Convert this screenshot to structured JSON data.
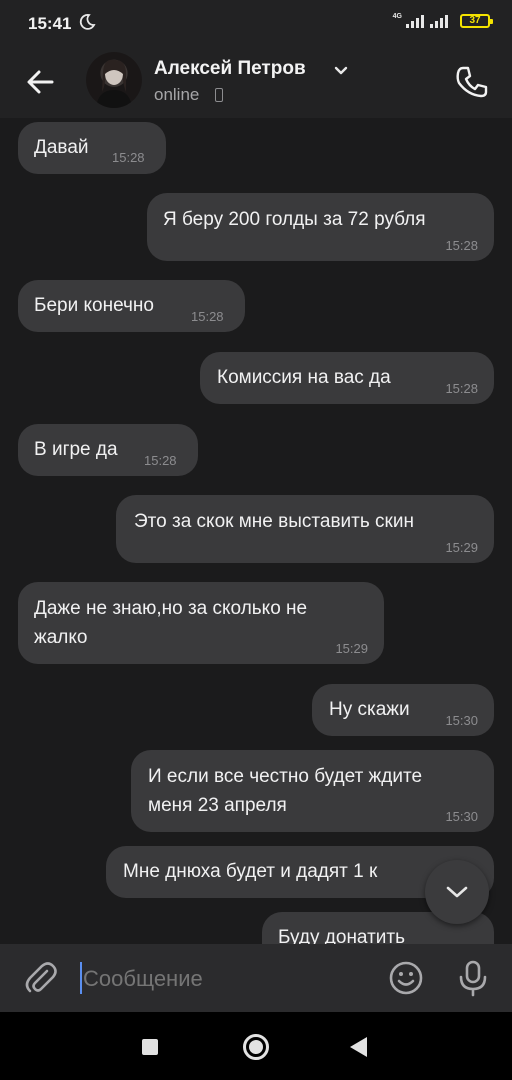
{
  "status_bar": {
    "time": "15:41",
    "network": "4G",
    "battery": "37",
    "icons": [
      "moon-icon",
      "signal-icon",
      "signal-icon",
      "battery-icon"
    ]
  },
  "header": {
    "contact_name": "Алексей Петров",
    "status": "online",
    "icons": [
      "back-arrow-icon",
      "chevron-down-icon",
      "phone-call-icon"
    ]
  },
  "messages": [
    {
      "direction": "incoming",
      "lines": [
        "Давай"
      ],
      "time": "15:28"
    },
    {
      "direction": "outgoing",
      "lines": [
        "Я беру 200 голды за 72 рубля"
      ],
      "time": "15:28"
    },
    {
      "direction": "incoming",
      "lines": [
        "Бери конечно"
      ],
      "time": "15:28"
    },
    {
      "direction": "outgoing",
      "lines": [
        "Комиссия на вас да"
      ],
      "time": "15:28"
    },
    {
      "direction": "incoming",
      "lines": [
        "В игре да"
      ],
      "time": "15:28"
    },
    {
      "direction": "outgoing",
      "lines": [
        "Это за скок мне выставить скин"
      ],
      "time": "15:29"
    },
    {
      "direction": "incoming",
      "lines": [
        "Даже не знаю,но за сколько не",
        "жалко"
      ],
      "time": "15:29"
    },
    {
      "direction": "outgoing",
      "lines": [
        "Ну скажи"
      ],
      "time": "15:30"
    },
    {
      "direction": "outgoing",
      "lines": [
        "И если все честно будет ждите",
        "меня 23 апреля"
      ],
      "time": "15:30"
    },
    {
      "direction": "outgoing",
      "lines": [
        "Мне днюха будет и дадят 1 к"
      ],
      "time": ""
    },
    {
      "direction": "outgoing",
      "lines": [
        "Буду донатить"
      ],
      "time": ""
    }
  ],
  "composer": {
    "placeholder": "Сообщение",
    "icons": [
      "attach-icon",
      "emoji-icon",
      "microphone-icon",
      "scroll-down-icon"
    ]
  },
  "navbar": {
    "icons": [
      "recents-square-icon",
      "home-circle-icon",
      "back-triangle-icon"
    ]
  },
  "colors": {
    "background": "#1b1b1c",
    "bubble": "#3a3a3c",
    "bar": "#222223",
    "battery": "#f4e300",
    "caret": "#5b8ff0"
  }
}
